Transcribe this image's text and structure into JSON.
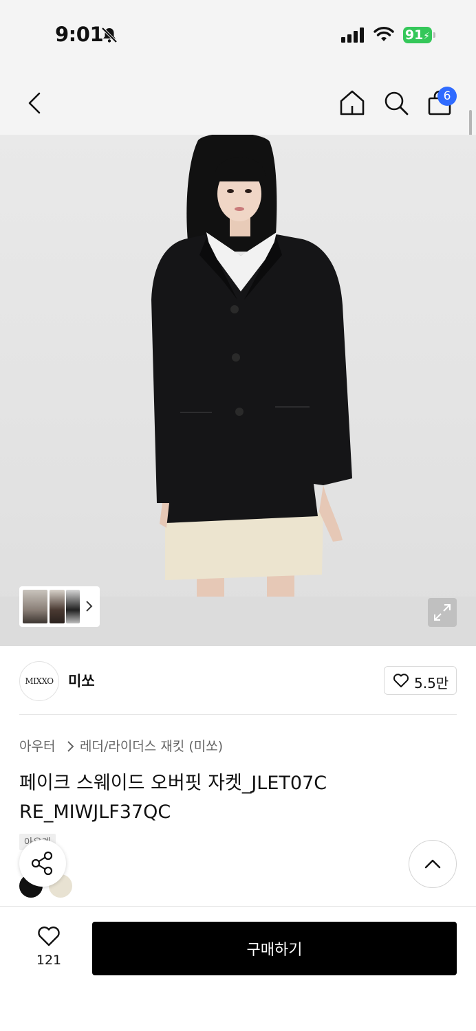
{
  "status_bar": {
    "time": "9:01",
    "battery": "91"
  },
  "nav": {
    "cart_count": "6"
  },
  "brand": {
    "logo_text": "MIXXO",
    "name": "미쏘",
    "likes": "5.5만"
  },
  "breadcrumb": {
    "level1": "아우터",
    "level2": "레더/라이더스 재킷 (미쏘)"
  },
  "product": {
    "title": "페이크 스웨이드 오버핏 자켓_JLET07C RE_MIWJLF37QC",
    "tag": "아우렛",
    "colors": [
      "#111111",
      "#e8e2d2"
    ]
  },
  "bottom_bar": {
    "wish_count": "121",
    "buy_label": "구매하기"
  },
  "colors": {
    "accent_badge": "#2f6bff",
    "battery": "#34c759",
    "primary_button": "#000000"
  }
}
